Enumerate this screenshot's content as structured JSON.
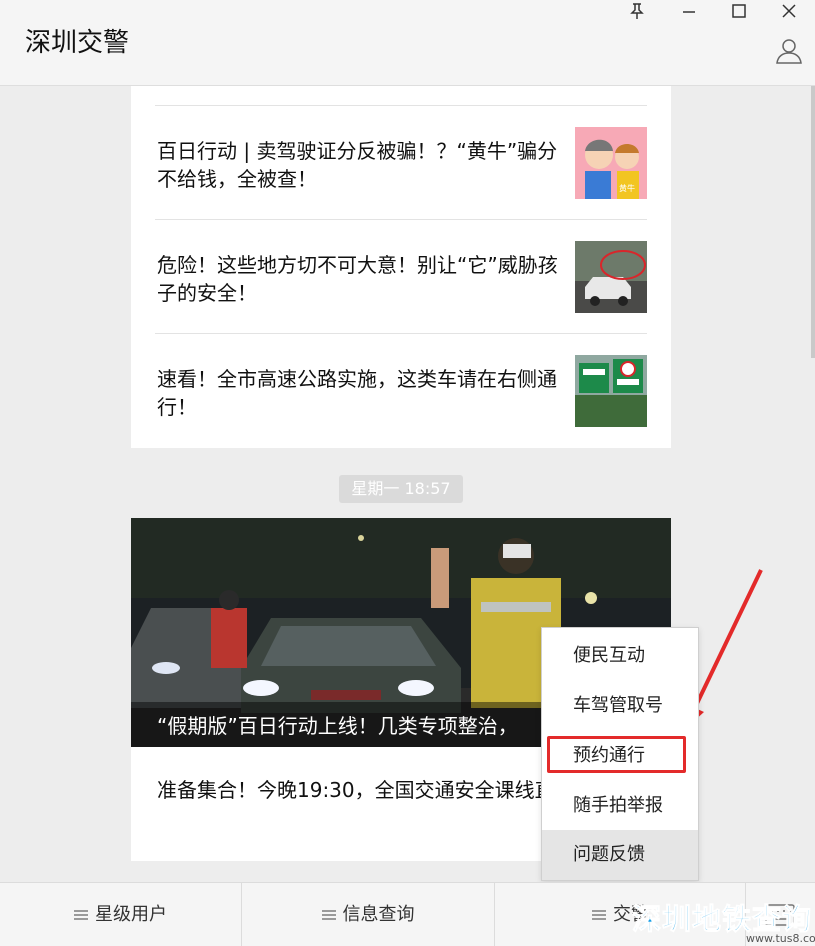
{
  "window": {
    "title": "深圳交警",
    "pin": "pin-icon",
    "minimize": "minimize-icon",
    "maximize": "maximize-icon",
    "close": "close-icon"
  },
  "articles": [
    {
      "title": "百日行动 | 卖驾驶证分反被骗！？“黄牛”骗分不给钱，全被查！",
      "thumb_label": "黄牛"
    },
    {
      "title": "危险！这些地方切不可大意！别让“它”威胁孩子的安全！"
    },
    {
      "title": "速看！全市高速公路实施，这类车请在右侧通行！"
    }
  ],
  "timestamp": "星期一  18:57",
  "cover": {
    "caption": "“假期版”百日行动上线！几类专项整治，"
  },
  "sub_article": {
    "title": "准备集合！今晚19:30，全国交通安全课线直播！"
  },
  "popup_menu": {
    "items": [
      "便民互动",
      "车驾管取号",
      "预约通行",
      "随手拍举报",
      "问题反馈"
    ],
    "highlighted": "预约通行",
    "hovered": "问题反馈"
  },
  "bottom_menu": {
    "tabs": [
      "星级用户",
      "信息查询",
      "交警"
    ]
  },
  "watermark": {
    "text": "深圳地铁查询",
    "url": "www.tus8.com"
  },
  "colors": {
    "accent_red": "#e32a2a",
    "background": "#ededed",
    "watermark_blue": "#1aa0e8"
  }
}
